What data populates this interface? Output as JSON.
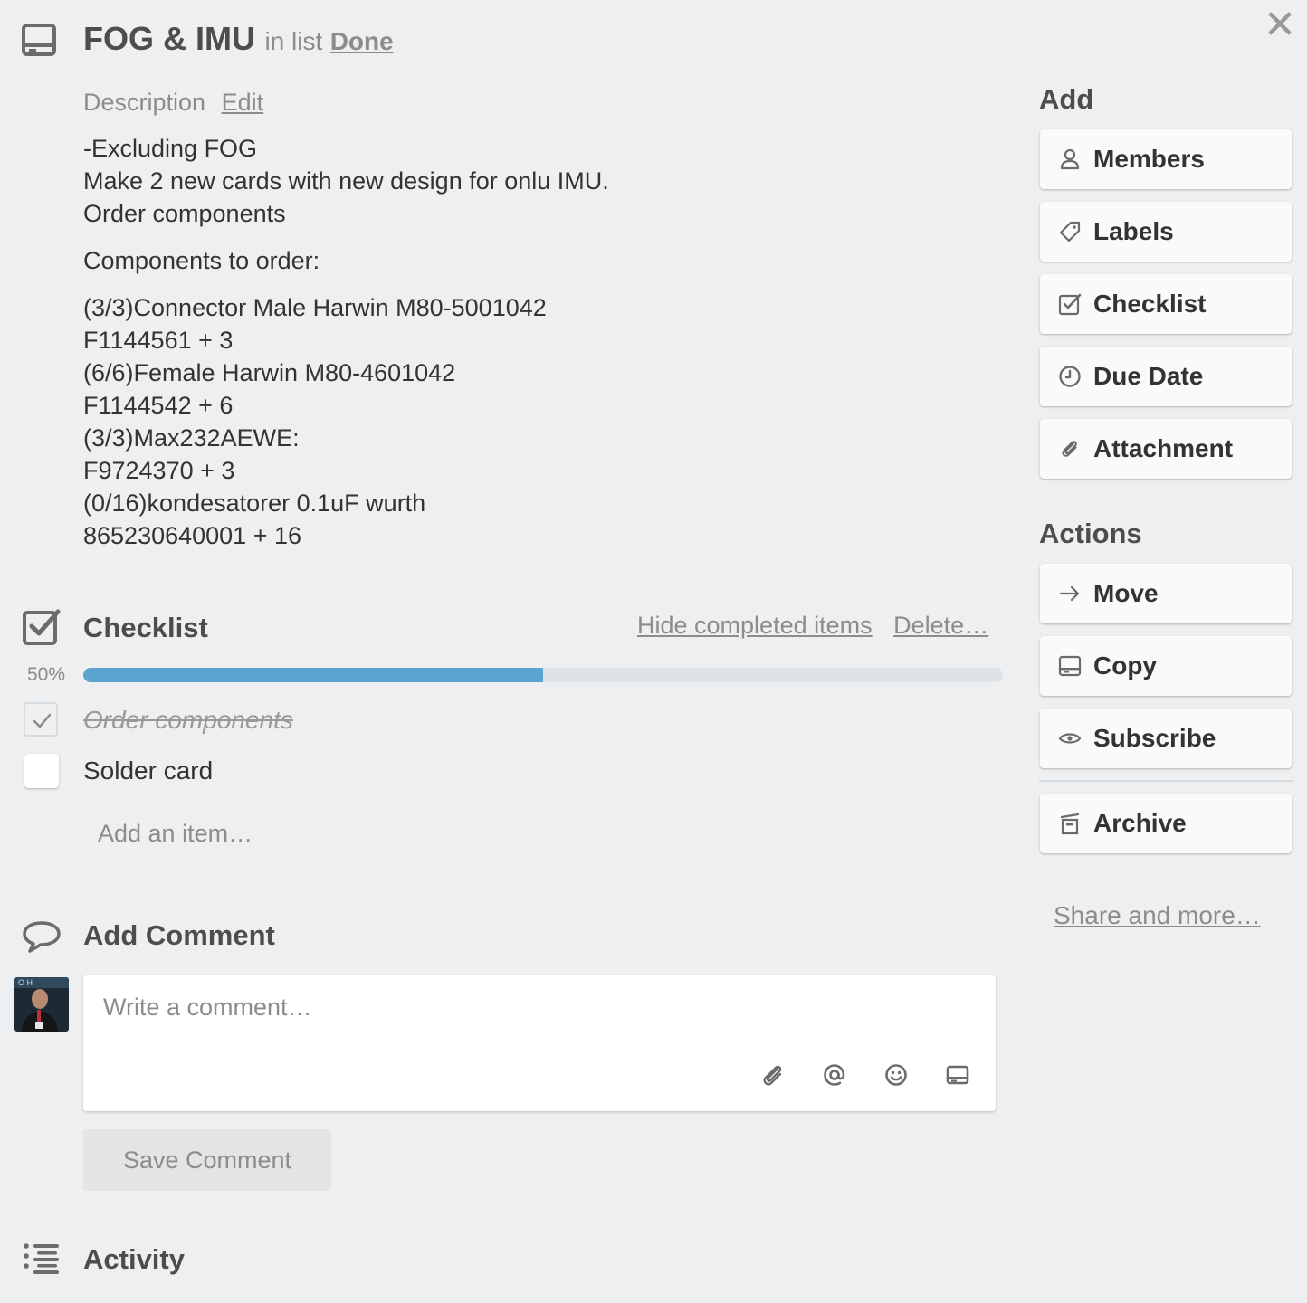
{
  "card": {
    "title": "FOG & IMU",
    "in_list_prefix": "in list",
    "list_name": "Done",
    "close_glyph": "✕"
  },
  "description": {
    "heading": "Description",
    "edit_label": "Edit",
    "lines_top": [
      "-Excluding FOG",
      "Make 2 new cards with new design for onlu IMU.",
      "Order components"
    ],
    "lines_mid": [
      "Components to order:"
    ],
    "lines_bottom": [
      "(3/3)Connector Male Harwin M80-5001042",
      "F1144561 + 3",
      "(6/6)Female Harwin M80-4601042",
      "F1144542 + 6",
      "(3/3)Max232AEWE:",
      "F9724370 + 3",
      "(0/16)kondesatorer 0.1uF wurth",
      "865230640001 + 16"
    ]
  },
  "checklist": {
    "title": "Checklist",
    "hide_completed_label": "Hide completed items",
    "delete_label": "Delete…",
    "progress_label": "50%",
    "progress": 0.5,
    "progress_color": "#5ba4cf",
    "items": [
      {
        "text": "Order components",
        "done": true
      },
      {
        "text": "Solder card",
        "done": false
      }
    ],
    "add_item_label": "Add an item…"
  },
  "comment": {
    "title": "Add Comment",
    "placeholder": "Write a comment…",
    "save_label": "Save Comment",
    "icons": [
      "attachment-icon",
      "mention-icon",
      "emoji-icon",
      "card-icon"
    ]
  },
  "activity": {
    "title": "Activity"
  },
  "sidebar": {
    "add_heading": "Add",
    "add_buttons": [
      {
        "label": "Members",
        "icon": "person-icon"
      },
      {
        "label": "Labels",
        "icon": "label-icon"
      },
      {
        "label": "Checklist",
        "icon": "checklist-icon"
      },
      {
        "label": "Due Date",
        "icon": "clock-icon"
      },
      {
        "label": "Attachment",
        "icon": "attachment-icon"
      }
    ],
    "actions_heading": "Actions",
    "action_buttons": [
      {
        "label": "Move",
        "icon": "arrow-right-icon"
      },
      {
        "label": "Copy",
        "icon": "card-icon"
      },
      {
        "label": "Subscribe",
        "icon": "eye-icon"
      }
    ],
    "archive_label": "Archive",
    "share_label": "Share and more…"
  }
}
